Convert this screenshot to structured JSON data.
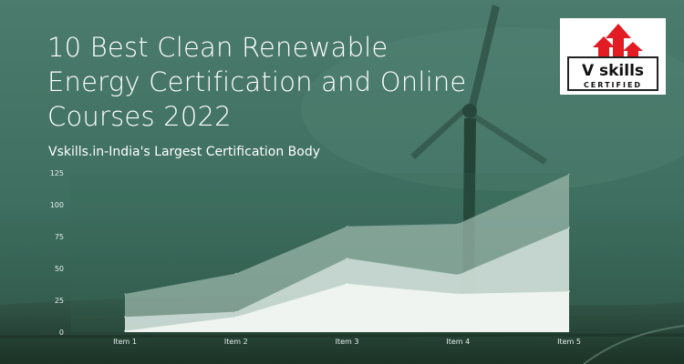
{
  "header": {
    "title_line_1": "10 Best Clean Renewable",
    "title_line_2": "Energy Certification and Online",
    "title_line_3": "Courses 2022",
    "subtitle": "Vskills.in-India's Largest Certification Body"
  },
  "logo": {
    "brand_text": "V skills",
    "certified_text": "CERTIFIED",
    "arrow_color": "#e31b23",
    "frame_color": "#222222"
  },
  "colors": {
    "background": "#3f7262",
    "series_back": "#9ab6aa",
    "series_middle": "#d3e2dc",
    "series_front": "#f3f6f4",
    "axis_text": "#e8efec"
  },
  "chart_data": {
    "type": "area",
    "categories": [
      "Item 1",
      "Item 2",
      "Item 3",
      "Item 4",
      "Item 5"
    ],
    "series": [
      {
        "values": [
          30,
          46,
          83,
          85,
          124
        ]
      },
      {
        "values": [
          12,
          16,
          58,
          45,
          82
        ]
      },
      {
        "values": [
          1,
          12,
          38,
          30,
          32
        ]
      }
    ],
    "ylim": [
      0,
      125
    ],
    "yticks": [
      0,
      25,
      50,
      75,
      100,
      125
    ],
    "grid": false,
    "legend": "none"
  }
}
